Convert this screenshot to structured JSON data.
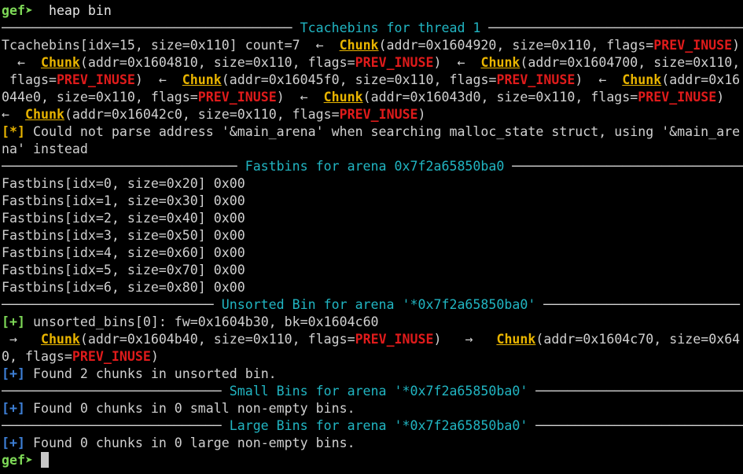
{
  "prompt": "gef➤",
  "command": "heap bin",
  "sections": {
    "tcache_title": "Tcachebins for thread 1",
    "fastbins_title": "Fastbins for arena 0x7f2a65850ba0",
    "unsorted_title": "Unsorted Bin for arena '*0x7f2a65850ba0'",
    "small_title": "Small Bins for arena '*0x7f2a65850ba0'",
    "large_title": "Large Bins for arena '*0x7f2a65850ba0'"
  },
  "chunk_word": "Chunk",
  "inuse_word": "PREV_INUSE",
  "tcache": {
    "header": "Tcachebins[idx=15, size=0x110] count=7",
    "chunks": [
      "0x1604920",
      "0x1604810",
      "0x1604700",
      "0x16045f0",
      "0x16044e0",
      "0x16043d0",
      "0x16042c0"
    ],
    "size": "0x110"
  },
  "warning": {
    "marker": "[*]",
    "text_line1": " Could not parse address '&main_arena' when searching malloc_state struct, using '&main_are",
    "text_line2": "na' instead"
  },
  "fastbins": [
    "Fastbins[idx=0, size=0x20] 0x00",
    "Fastbins[idx=1, size=0x30] 0x00",
    "Fastbins[idx=2, size=0x40] 0x00",
    "Fastbins[idx=3, size=0x50] 0x00",
    "Fastbins[idx=4, size=0x60] 0x00",
    "Fastbins[idx=5, size=0x70] 0x00",
    "Fastbins[idx=6, size=0x80] 0x00"
  ],
  "unsorted": {
    "marker": "[+]",
    "header": " unsorted_bins[0]: fw=0x1604b30, bk=0x1604c60",
    "chunk1": "0x1604b40",
    "chunk2": "0x1604c70",
    "size": "0x110",
    "found_marker": "[+]",
    "found": " Found 2 chunks in unsorted bin."
  },
  "small": {
    "marker": "[+]",
    "found": " Found 0 chunks in 0 small non-empty bins."
  },
  "large": {
    "marker": "[+]",
    "found": " Found 0 chunks in 0 large non-empty bins."
  }
}
